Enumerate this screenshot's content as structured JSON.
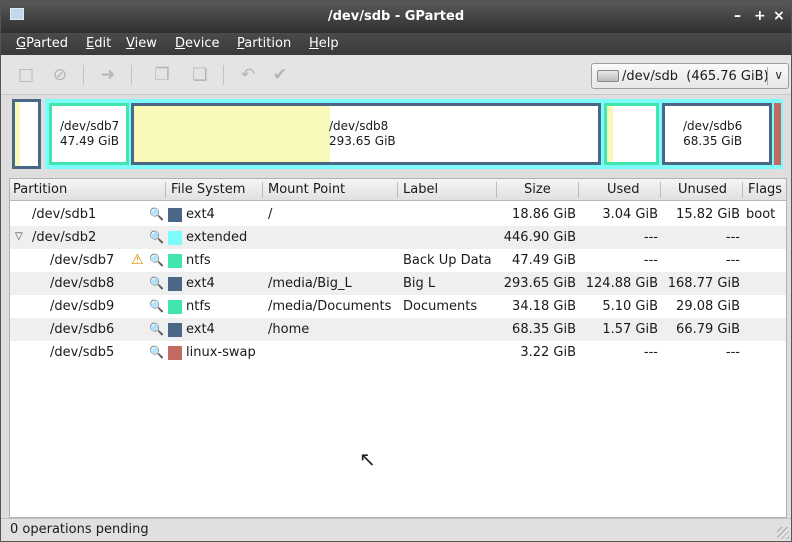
{
  "window": {
    "title": "/dev/sdb - GParted",
    "controls": [
      "–",
      "+",
      "×"
    ]
  },
  "menu": [
    {
      "u": "G",
      "rest": "Parted"
    },
    {
      "u": "E",
      "rest": "dit"
    },
    {
      "u": "V",
      "rest": "iew"
    },
    {
      "u": "D",
      "rest": "evice"
    },
    {
      "u": "P",
      "rest": "artition"
    },
    {
      "u": "H",
      "rest": "elp"
    }
  ],
  "toolbar": {
    "icons": [
      "new-icon",
      "delete-icon",
      "resize-move-icon",
      "copy-icon",
      "paste-icon",
      "undo-icon",
      "apply-icon"
    ],
    "device": "/dev/sdb  (465.76 GiB)"
  },
  "graph": {
    "sdb7": {
      "name": "/dev/sdb7",
      "size": "47.49 GiB"
    },
    "sdb8": {
      "name": "/dev/sdb8",
      "size": "293.65 GiB"
    },
    "sdb6": {
      "name": "/dev/sdb6",
      "size": "68.35 GiB"
    }
  },
  "columns": [
    "Partition",
    "File System",
    "Mount Point",
    "Label",
    "Size",
    "Used",
    "Unused",
    "Flags"
  ],
  "rows": [
    {
      "partition": "/dev/sdb1",
      "fs": "ext4",
      "mount": "/",
      "label": "",
      "size": "18.86 GiB",
      "used": "3.04 GiB",
      "unused": "15.82 GiB",
      "flags": "boot"
    },
    {
      "partition": "/dev/sdb2",
      "fs": "extended",
      "mount": "",
      "label": "",
      "size": "446.90 GiB",
      "used": "---",
      "unused": "---",
      "flags": ""
    },
    {
      "partition": "/dev/sdb7",
      "fs": "ntfs",
      "mount": "",
      "label": "Back Up Data",
      "size": "47.49 GiB",
      "used": "---",
      "unused": "---",
      "flags": ""
    },
    {
      "partition": "/dev/sdb8",
      "fs": "ext4",
      "mount": "/media/Big_L",
      "label": "Big L",
      "size": "293.65 GiB",
      "used": "124.88 GiB",
      "unused": "168.77 GiB",
      "flags": ""
    },
    {
      "partition": "/dev/sdb9",
      "fs": "ntfs",
      "mount": "/media/Documents",
      "label": "Documents",
      "size": "34.18 GiB",
      "used": "5.10 GiB",
      "unused": "29.08 GiB",
      "flags": ""
    },
    {
      "partition": "/dev/sdb6",
      "fs": "ext4",
      "mount": "/home",
      "label": "",
      "size": "68.35 GiB",
      "used": "1.57 GiB",
      "unused": "66.79 GiB",
      "flags": ""
    },
    {
      "partition": "/dev/sdb5",
      "fs": "linux-swap",
      "mount": "",
      "label": "",
      "size": "3.22 GiB",
      "used": "---",
      "unused": "---",
      "flags": ""
    }
  ],
  "colors": {
    "ext4": "#4a6786",
    "extended": "#7dfbfa",
    "ntfs": "#42e5ac",
    "linux-swap": "#c26a62",
    "used": "#f8f8b8"
  },
  "status": "0 operations pending"
}
